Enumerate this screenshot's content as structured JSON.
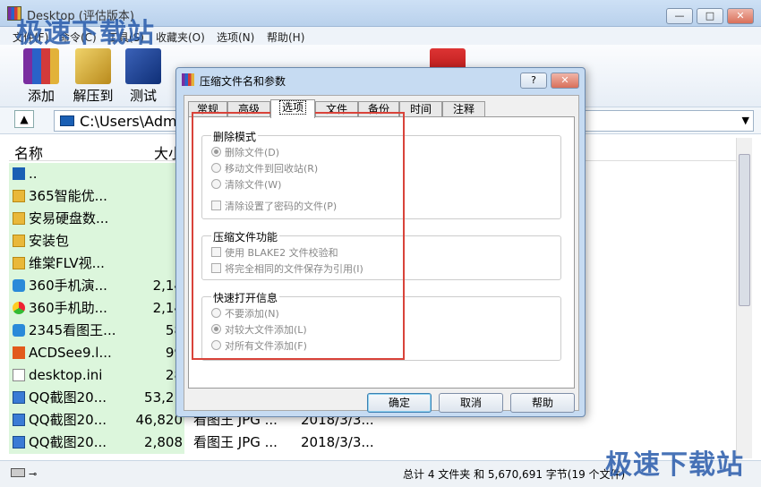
{
  "window": {
    "title": "Desktop (评估版本)"
  },
  "menu": [
    "文件(F)",
    "命令(C)",
    "工具(S)",
    "收藏夹(O)",
    "选项(N)",
    "帮助(H)"
  ],
  "toolbar": {
    "add": "添加",
    "extract": "解压到",
    "test": "测试"
  },
  "address": {
    "path": "C:\\Users\\Admi"
  },
  "columns": {
    "name": "名称",
    "size": "大小"
  },
  "files": [
    {
      "name": "..",
      "size": "",
      "type": "",
      "date": "",
      "icon": "return-icon"
    },
    {
      "name": "365智能优...",
      "size": "",
      "type": "",
      "date": "",
      "icon": "folder-icon"
    },
    {
      "name": "安易硬盘数...",
      "size": "",
      "type": "",
      "date": "",
      "icon": "folder-icon"
    },
    {
      "name": "安装包",
      "size": "",
      "type": "",
      "date": "",
      "icon": "folder-icon"
    },
    {
      "name": "维棠FLV视...",
      "size": "",
      "type": "",
      "date": "",
      "icon": "folder-icon"
    },
    {
      "name": "360手机演...",
      "size": "2,14",
      "type": "",
      "date": "",
      "icon": "app-icon"
    },
    {
      "name": "360手机助...",
      "size": "2,14",
      "type": "",
      "date": "",
      "icon": "app-icon"
    },
    {
      "name": "2345看图王...",
      "size": "58",
      "type": "",
      "date": "",
      "icon": "app-icon"
    },
    {
      "name": "ACDSee9.l...",
      "size": "99",
      "type": "",
      "date": "",
      "icon": "app-icon"
    },
    {
      "name": "desktop.ini",
      "size": "28",
      "type": "",
      "date": "",
      "icon": "file-icon"
    },
    {
      "name": "QQ截图20...",
      "size": "53,21",
      "type": "",
      "date": "",
      "icon": "jpg-icon"
    },
    {
      "name": "QQ截图20...",
      "size": "46,820",
      "type": "看图王 JPG ...",
      "date": "2018/3/3...",
      "icon": "jpg-icon"
    },
    {
      "name": "QQ截图20...",
      "size": "2,808",
      "type": "看图王 JPG ...",
      "date": "2018/3/3...",
      "icon": "jpg-icon"
    }
  ],
  "status": {
    "summary": "总计 4 文件夹 和 5,670,691 字节(19 个文件)"
  },
  "watermark": "极速下载站",
  "dialog": {
    "title": "压缩文件名和参数",
    "help_btn": "?",
    "close_btn": "✕",
    "tabs": [
      "常规",
      "高级",
      "选项",
      "文件",
      "备份",
      "时间",
      "注释"
    ],
    "active_tab": "选项",
    "groups": {
      "delete_mode": {
        "title": "删除模式",
        "options": [
          "删除文件(D)",
          "移动文件到回收站(R)",
          "清除文件(W)"
        ],
        "checkbox": "清除设置了密码的文件(P)"
      },
      "compress_features": {
        "title": "压缩文件功能",
        "checkboxes": [
          "使用 BLAKE2 文件校验和",
          "将完全相同的文件保存为引用(I)"
        ]
      },
      "quick_open": {
        "title": "快速打开信息",
        "options": [
          "不要添加(N)",
          "对较大文件添加(L)",
          "对所有文件添加(F)"
        ]
      }
    },
    "buttons": {
      "ok": "确定",
      "cancel": "取消",
      "help": "帮助"
    }
  },
  "colors": {
    "highlight_box": "#d9433a",
    "name_column_bg": "#dcf6dc",
    "dialog_frame": "#c6dbf2"
  }
}
